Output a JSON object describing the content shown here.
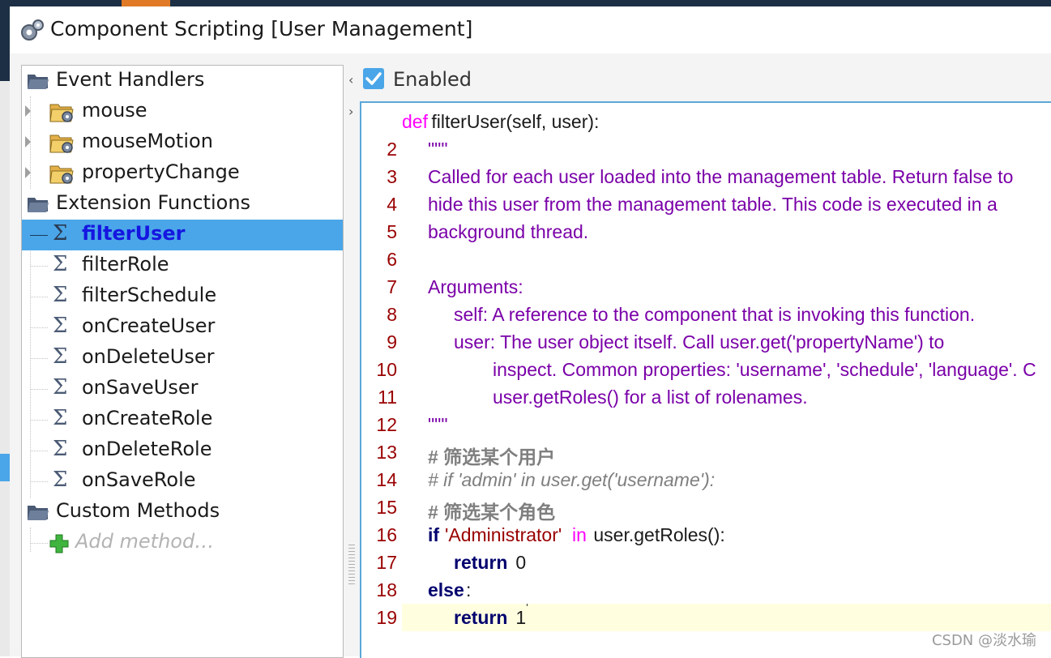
{
  "window": {
    "title": "Component Scripting [User Management]"
  },
  "tree": {
    "event_handlers": {
      "label": "Event Handlers",
      "items": [
        {
          "label": "mouse"
        },
        {
          "label": "mouseMotion"
        },
        {
          "label": "propertyChange"
        }
      ]
    },
    "extension_functions": {
      "label": "Extension Functions",
      "selected": "filterUser",
      "items": [
        {
          "label": "filterUser"
        },
        {
          "label": "filterRole"
        },
        {
          "label": "filterSchedule"
        },
        {
          "label": "onCreateUser"
        },
        {
          "label": "onDeleteUser"
        },
        {
          "label": "onSaveUser"
        },
        {
          "label": "onCreateRole"
        },
        {
          "label": "onDeleteRole"
        },
        {
          "label": "onSaveRole"
        }
      ]
    },
    "custom_methods": {
      "label": "Custom Methods",
      "add_label": "Add method…"
    }
  },
  "editor": {
    "enabled_label": "Enabled",
    "enabled": true,
    "current_line": 19,
    "line_numbers": [
      "",
      "2",
      "3",
      "4",
      "5",
      "6",
      "7",
      "8",
      "9",
      "10",
      "11",
      "12",
      "13",
      "14",
      "15",
      "16",
      "17",
      "18",
      "19"
    ],
    "code": {
      "l1_def": "def",
      "l1_rest": " filterUser(self, user):",
      "l2": "\"\"\"",
      "l3": "Called for each user loaded into the management table. Return false to",
      "l4": "hide this user from the management table. This code is executed in a",
      "l5": "background thread.",
      "l7": "Arguments:",
      "l8": "self: A reference to the component that is invoking this function.",
      "l9": "user: The user object itself. Call user.get('propertyName') to",
      "l10": "inspect. Common properties: 'username', 'schedule', 'language'. C",
      "l11": "user.getRoles() for a list of rolenames.",
      "l12": "\"\"\"",
      "l13": "# 筛选某个用户",
      "l14": "# if 'admin' in user.get('username'):",
      "l15": "# 筛选某个角色",
      "l16_if": "if",
      "l16_str": "'Administrator'",
      "l16_in": "in",
      "l16_rest": " user.getRoles():",
      "l17_kw": "return",
      "l17_val": " 0",
      "l18_kw": "else",
      "l18_rest": ":",
      "l19_kw": "return",
      "l19_val": " 1"
    }
  },
  "watermark": "CSDN @淡水瑜"
}
